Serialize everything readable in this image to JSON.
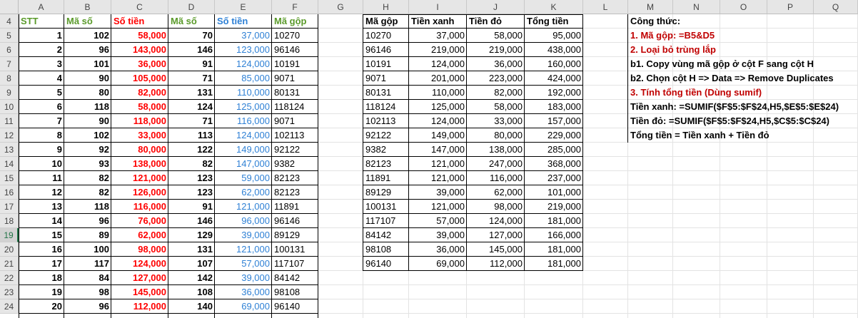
{
  "columns": [
    "A",
    "B",
    "C",
    "D",
    "E",
    "F",
    "G",
    "H",
    "I",
    "J",
    "K",
    "L",
    "M",
    "N",
    "O",
    "P",
    "Q"
  ],
  "row_numbers": [
    4,
    5,
    6,
    7,
    8,
    9,
    10,
    11,
    12,
    13,
    14,
    15,
    16,
    17,
    18,
    19,
    20,
    21,
    22,
    23,
    24
  ],
  "selected_row": 19,
  "left_table": {
    "headers": [
      "STT",
      "Mã số",
      "Số tiền",
      "Mã số",
      "Số tiền",
      "Mã gộp"
    ],
    "rows": [
      [
        "1",
        "102",
        "58,000",
        "70",
        "37,000",
        "10270"
      ],
      [
        "2",
        "96",
        "143,000",
        "146",
        "123,000",
        "96146"
      ],
      [
        "3",
        "101",
        "36,000",
        "91",
        "124,000",
        "10191"
      ],
      [
        "4",
        "90",
        "105,000",
        "71",
        "85,000",
        "9071"
      ],
      [
        "5",
        "80",
        "82,000",
        "131",
        "110,000",
        "80131"
      ],
      [
        "6",
        "118",
        "58,000",
        "124",
        "125,000",
        "118124"
      ],
      [
        "7",
        "90",
        "118,000",
        "71",
        "116,000",
        "9071"
      ],
      [
        "8",
        "102",
        "33,000",
        "113",
        "124,000",
        "102113"
      ],
      [
        "9",
        "92",
        "80,000",
        "122",
        "149,000",
        "92122"
      ],
      [
        "10",
        "93",
        "138,000",
        "82",
        "147,000",
        "9382"
      ],
      [
        "11",
        "82",
        "121,000",
        "123",
        "59,000",
        "82123"
      ],
      [
        "12",
        "82",
        "126,000",
        "123",
        "62,000",
        "82123"
      ],
      [
        "13",
        "118",
        "116,000",
        "91",
        "121,000",
        "11891"
      ],
      [
        "14",
        "96",
        "76,000",
        "146",
        "96,000",
        "96146"
      ],
      [
        "15",
        "89",
        "62,000",
        "129",
        "39,000",
        "89129"
      ],
      [
        "16",
        "100",
        "98,000",
        "131",
        "121,000",
        "100131"
      ],
      [
        "17",
        "117",
        "124,000",
        "107",
        "57,000",
        "117107"
      ],
      [
        "18",
        "84",
        "127,000",
        "142",
        "39,000",
        "84142"
      ],
      [
        "19",
        "98",
        "145,000",
        "108",
        "36,000",
        "98108"
      ],
      [
        "20",
        "96",
        "112,000",
        "140",
        "69,000",
        "96140"
      ]
    ]
  },
  "summary_table": {
    "headers": [
      "Mã gộp",
      "Tiền xanh",
      "Tiền đỏ",
      "Tổng tiền"
    ],
    "rows": [
      [
        "10270",
        "37,000",
        "58,000",
        "95,000"
      ],
      [
        "96146",
        "219,000",
        "219,000",
        "438,000"
      ],
      [
        "10191",
        "124,000",
        "36,000",
        "160,000"
      ],
      [
        "9071",
        "201,000",
        "223,000",
        "424,000"
      ],
      [
        "80131",
        "110,000",
        "82,000",
        "192,000"
      ],
      [
        "118124",
        "125,000",
        "58,000",
        "183,000"
      ],
      [
        "102113",
        "124,000",
        "33,000",
        "157,000"
      ],
      [
        "92122",
        "149,000",
        "80,000",
        "229,000"
      ],
      [
        "9382",
        "147,000",
        "138,000",
        "285,000"
      ],
      [
        "82123",
        "121,000",
        "247,000",
        "368,000"
      ],
      [
        "11891",
        "121,000",
        "116,000",
        "237,000"
      ],
      [
        "89129",
        "39,000",
        "62,000",
        "101,000"
      ],
      [
        "100131",
        "121,000",
        "98,000",
        "219,000"
      ],
      [
        "117107",
        "57,000",
        "124,000",
        "181,000"
      ],
      [
        "84142",
        "39,000",
        "127,000",
        "166,000"
      ],
      [
        "98108",
        "36,000",
        "145,000",
        "181,000"
      ],
      [
        "96140",
        "69,000",
        "112,000",
        "181,000"
      ]
    ]
  },
  "notes": {
    "title": "Công thức:",
    "step1": "1. Mã gộp: =B5&D5",
    "step2": "2. Loại bỏ trùng lắp",
    "step2a": "b1. Copy vùng mã gộp ở cột F sang cột H",
    "step2b": "b2. Chọn cột H => Data => Remove Duplicates",
    "step3": "3. Tính tổng tiền (Dùng sumif)",
    "formula_blue": "Tiền xanh: =SUMIF($F$5:$F$24,H5,$E$5:$E$24)",
    "formula_red": "Tiền đỏ: =SUMIF($F$5:$F$24,H5,$C$5:$C$24)",
    "formula_total": "Tổng tiền = Tiền xanh + Tiền đỏ"
  },
  "colors": {
    "red": "#ff0000",
    "blue": "#2f81d5",
    "green": "#5a9a2a",
    "dark_red": "#c00000",
    "header_bg": "#e6e6e6",
    "selected_accent": "#217346"
  }
}
